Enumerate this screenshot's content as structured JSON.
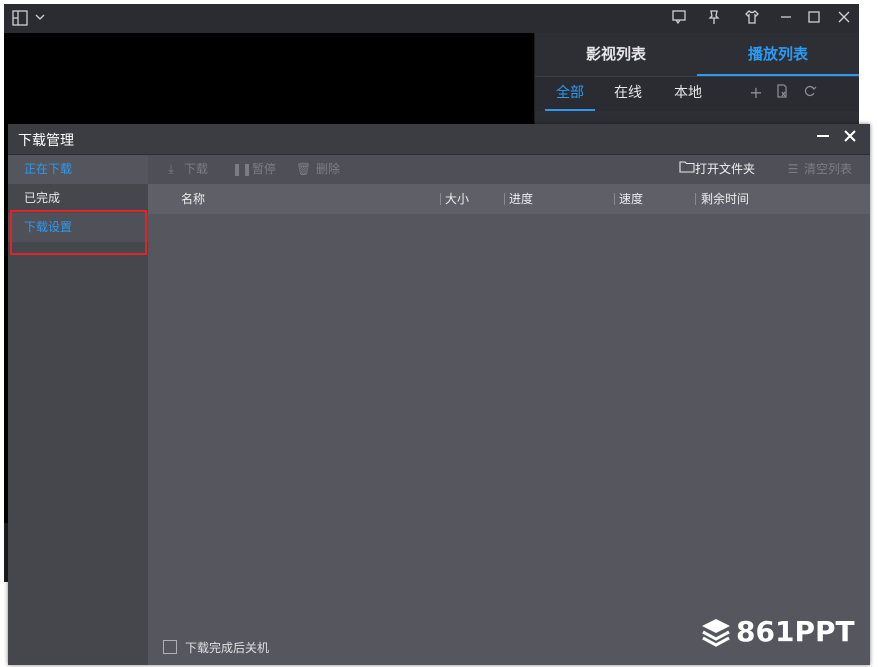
{
  "player": {
    "side_tabs": [
      "影视列表",
      "播放列表"
    ],
    "side_tab_active": 1,
    "filters": [
      "全部",
      "在线",
      "本地"
    ],
    "filter_active": 0
  },
  "dialog": {
    "title": "下载管理",
    "nav": [
      "正在下载",
      "已完成",
      "下载设置"
    ],
    "toolbar": {
      "download": "下载",
      "pause": "暂停",
      "delete": "删除",
      "open_folder": "打开文件夹",
      "clear_list": "清空列表"
    },
    "columns": [
      "名称",
      "大小",
      "进度",
      "速度",
      "剩余时间"
    ],
    "shutdown_label": "下载完成后关机"
  },
  "watermark": "861PPT",
  "colors": {
    "accent": "#2b9af3",
    "highlight_box": "#e0242a",
    "dialog_bg": "#56575e",
    "player_bg": "#1e1f23"
  }
}
